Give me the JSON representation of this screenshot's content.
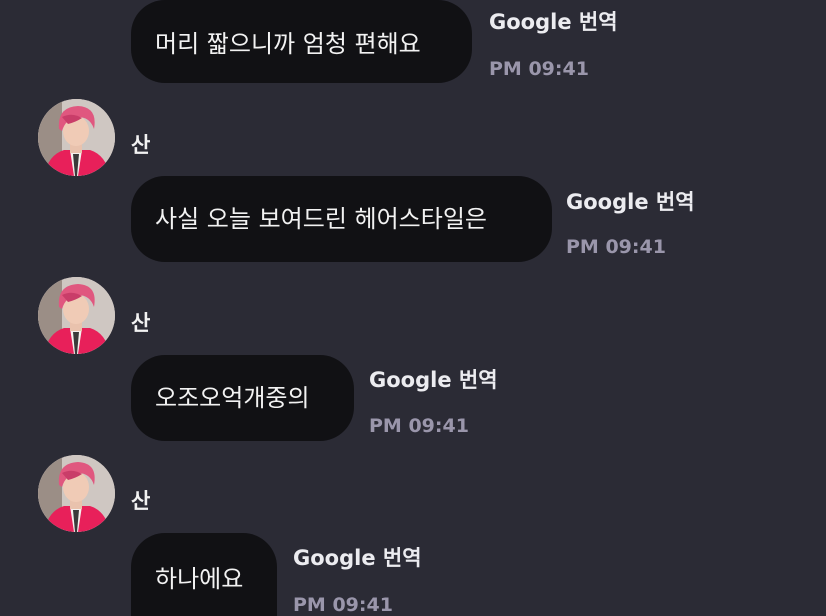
{
  "colors": {
    "background": "#2b2b35",
    "bubble": "#111114",
    "message_text": "#f2f2f2",
    "time_text": "#9a96ab",
    "avatar_hair": "#e0577f",
    "avatar_jacket": "#e8205a"
  },
  "messages": [
    {
      "text": "머리 짧으니까 엄청 편해요",
      "translate_label": "Google 번역",
      "time": "PM 09:41"
    },
    {
      "sender": "산",
      "avatar_icon": "profile-avatar-icon",
      "text": "사실 오늘 보여드린 헤어스타일은",
      "translate_label": "Google 번역",
      "time": "PM 09:41"
    },
    {
      "sender": "산",
      "avatar_icon": "profile-avatar-icon",
      "text": "오조오억개중의",
      "translate_label": "Google 번역",
      "time": "PM 09:41"
    },
    {
      "sender": "산",
      "avatar_icon": "profile-avatar-icon",
      "text": "하나에요",
      "translate_label": "Google 번역",
      "time": "PM 09:41"
    }
  ]
}
